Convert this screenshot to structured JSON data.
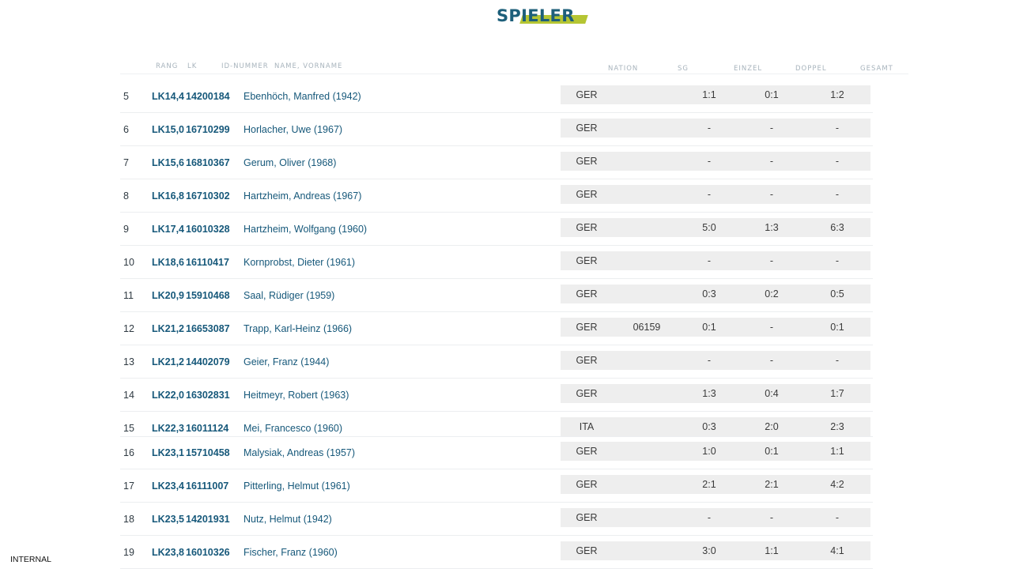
{
  "page": {
    "title": "SPIELER",
    "footer": "INTERNAL"
  },
  "headers": {
    "rang": "RANG",
    "lk": "LK",
    "id": "ID-NUMMER",
    "name": "NAME, VORNAME",
    "nation": "NATION",
    "sg": "SG",
    "einzel": "EINZEL",
    "doppel": "DOPPEL",
    "gesamt": "GESAMT"
  },
  "players": [
    {
      "rank": "5",
      "lk": "LK14,4",
      "id": "14200184",
      "name": "Ebenhöch, Manfred (1942)",
      "nation": "GER",
      "code": "",
      "sg": "1:1",
      "einzel": "0:1",
      "doppel": "1:2"
    },
    {
      "rank": "6",
      "lk": "LK15,0",
      "id": "16710299",
      "name": "Horlacher, Uwe (1967)",
      "nation": "GER",
      "code": "",
      "sg": "-",
      "einzel": "-",
      "doppel": "-"
    },
    {
      "rank": "7",
      "lk": "LK15,6",
      "id": "16810367",
      "name": "Gerum, Oliver (1968)",
      "nation": "GER",
      "code": "",
      "sg": "-",
      "einzel": "-",
      "doppel": "-"
    },
    {
      "rank": "8",
      "lk": "LK16,8",
      "id": "16710302",
      "name": "Hartzheim, Andreas (1967)",
      "nation": "GER",
      "code": "",
      "sg": "-",
      "einzel": "-",
      "doppel": "-"
    },
    {
      "rank": "9",
      "lk": "LK17,4",
      "id": "16010328",
      "name": "Hartzheim, Wolfgang (1960)",
      "nation": "GER",
      "code": "",
      "sg": "5:0",
      "einzel": "1:3",
      "doppel": "6:3"
    },
    {
      "rank": "10",
      "lk": "LK18,6",
      "id": "16110417",
      "name": "Kornprobst, Dieter (1961)",
      "nation": "GER",
      "code": "",
      "sg": "-",
      "einzel": "-",
      "doppel": "-"
    },
    {
      "rank": "11",
      "lk": "LK20,9",
      "id": "15910468",
      "name": "Saal, Rüdiger (1959)",
      "nation": "GER",
      "code": "",
      "sg": "0:3",
      "einzel": "0:2",
      "doppel": "0:5"
    },
    {
      "rank": "12",
      "lk": "LK21,2",
      "id": "16653087",
      "name": "Trapp, Karl-Heinz (1966)",
      "nation": "GER",
      "code": "06159",
      "sg": "0:1",
      "einzel": "-",
      "doppel": "0:1"
    },
    {
      "rank": "13",
      "lk": "LK21,2",
      "id": "14402079",
      "name": "Geier, Franz (1944)",
      "nation": "GER",
      "code": "",
      "sg": "-",
      "einzel": "-",
      "doppel": "-"
    },
    {
      "rank": "14",
      "lk": "LK22,0",
      "id": "16302831",
      "name": "Heitmeyr, Robert (1963)",
      "nation": "GER",
      "code": "",
      "sg": "1:3",
      "einzel": "0:4",
      "doppel": "1:7"
    },
    {
      "rank": "15",
      "lk": "LK22,3",
      "id": "16011124",
      "name": "Mei, Francesco (1960)",
      "nation": "ITA",
      "code": "",
      "sg": "0:3",
      "einzel": "2:0",
      "doppel": "2:3"
    },
    {
      "rank": "16",
      "lk": "LK23,1",
      "id": "15710458",
      "name": "Malysiak, Andreas (1957)",
      "nation": "GER",
      "code": "",
      "sg": "1:0",
      "einzel": "0:1",
      "doppel": "1:1"
    },
    {
      "rank": "17",
      "lk": "LK23,4",
      "id": "16111007",
      "name": "Pitterling, Helmut (1961)",
      "nation": "GER",
      "code": "",
      "sg": "2:1",
      "einzel": "2:1",
      "doppel": "4:2"
    },
    {
      "rank": "18",
      "lk": "LK23,5",
      "id": "14201931",
      "name": "Nutz, Helmut (1942)",
      "nation": "GER",
      "code": "",
      "sg": "-",
      "einzel": "-",
      "doppel": "-"
    },
    {
      "rank": "19",
      "lk": "LK23,8",
      "id": "16010326",
      "name": "Fischer, Franz (1960)",
      "nation": "GER",
      "code": "",
      "sg": "3:0",
      "einzel": "1:1",
      "doppel": "4:1"
    }
  ]
}
